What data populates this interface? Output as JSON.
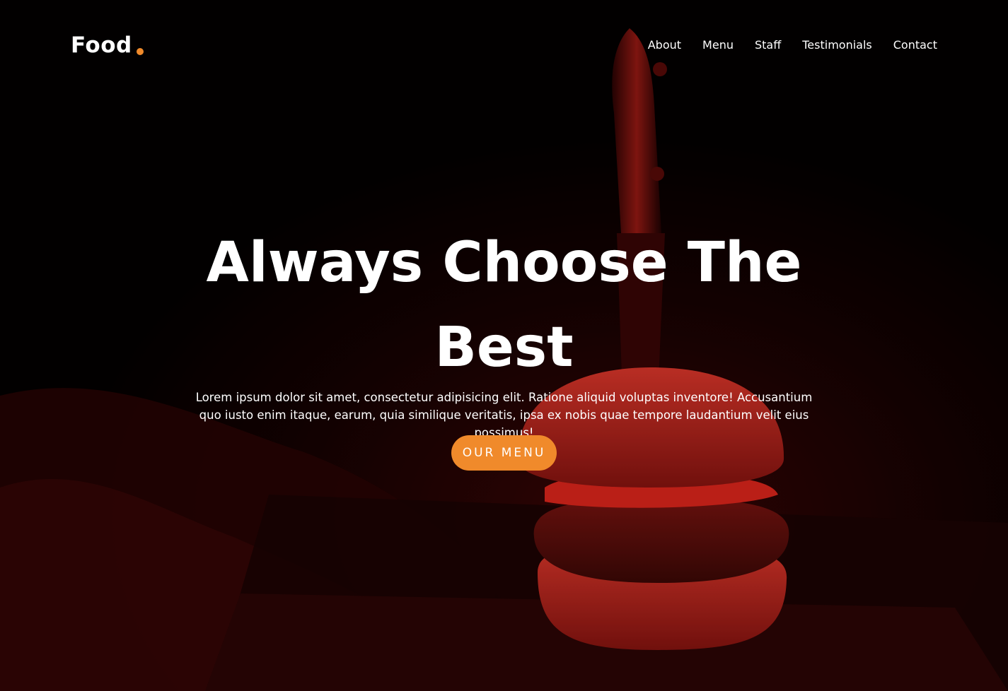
{
  "brand": {
    "name": "Food",
    "accent_color": "#f08a2b"
  },
  "nav": {
    "items": [
      {
        "label": "About"
      },
      {
        "label": "Menu"
      },
      {
        "label": "Staff"
      },
      {
        "label": "Testimonials"
      },
      {
        "label": "Contact"
      }
    ]
  },
  "hero": {
    "title": "Always Choose The Best",
    "subtitle": "Lorem ipsum dolor sit amet, consectetur adipisicing elit. Ratione aliquid voluptas inventore! Accusantium quo iusto enim itaque, earum, quia similique veritatis, ipsa ex nobis quae tempore laudantium velit eius possimus!",
    "cta_label": "OUR MENU",
    "cta_color": "#f08a2b",
    "background_tint": "#c81e1e",
    "image_subject": "burger-with-knife-image"
  }
}
